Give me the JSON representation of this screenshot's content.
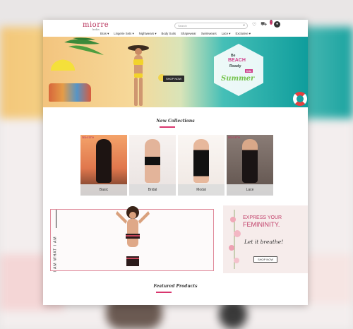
{
  "header": {
    "logo_text": "miorre",
    "logo_sub": "India",
    "search_placeholder": "Search",
    "cart_count": "0",
    "nav": [
      "Bras ▾",
      "Lingerie Sets ▾",
      "Nightwears ▾",
      "Body Suits",
      "Shapewear",
      "Swimwears",
      "Lace ▾",
      "Exclusive ▾"
    ]
  },
  "banner": {
    "shop_now": "SHOP NOW",
    "line1": "Be",
    "line2": "BEACH",
    "line3": "Ready",
    "line4": "this",
    "line5": "Summer"
  },
  "collections": {
    "title": "New Collections",
    "tag": "miorre",
    "cards": [
      "Basic",
      "Bridal",
      "Modal",
      "Lace"
    ]
  },
  "promo": {
    "vertical_text": "I AM WHAT I AM",
    "headline1": "EXPRESS YOUR",
    "headline2": "FEMININITY.",
    "script": "Let it breathe!",
    "button": "SHOP NOW"
  },
  "featured": {
    "title": "Featured Products"
  },
  "colors": {
    "brand": "#b7355d",
    "accent": "#d9366e"
  }
}
